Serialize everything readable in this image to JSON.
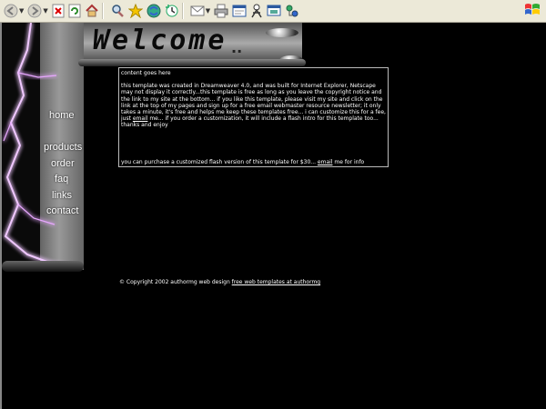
{
  "browser": {
    "toolbar_icons": [
      "back-icon",
      "forward-icon",
      "stop-icon",
      "refresh-icon",
      "home-icon",
      "search-icon",
      "favorites-icon",
      "media-icon",
      "history-icon",
      "mail-icon",
      "print-icon",
      "edit-icon",
      "messenger-icon",
      "discuss-icon",
      "research-icon"
    ]
  },
  "header": {
    "welcome_text": "Welcome",
    "dots": ".."
  },
  "nav": {
    "items": [
      "home",
      "products",
      "order",
      "faq",
      "links",
      "contact"
    ]
  },
  "content": {
    "placeholder": "content goes here",
    "paragraph_pre_link": "this template was created in Dreamweaver 4.0, and was built for Internet Explorer, Netscape may not display it correctly...this template is free as long as you leave the copyright notice and the link to my site at the bottom... if you like this template, please visit my site and click on the link at the top of my pages and sign up for a free email webmaster resource newsletter; it only takes a minute, it's free and helps me keep these templates free... i can customize this for a fee, just ",
    "email_link": "email",
    "paragraph_post_link": " me... if you order a customization, it will include a flash intro for this template too... thanks and enjoy",
    "bottom_pre": "you can purchase a customized flash version of this template for $30... ",
    "bottom_link": "email",
    "bottom_post": " me for info"
  },
  "footer": {
    "copyright": "© Copyright 2002 authormg web design ",
    "link": "free web templates at authormg"
  }
}
